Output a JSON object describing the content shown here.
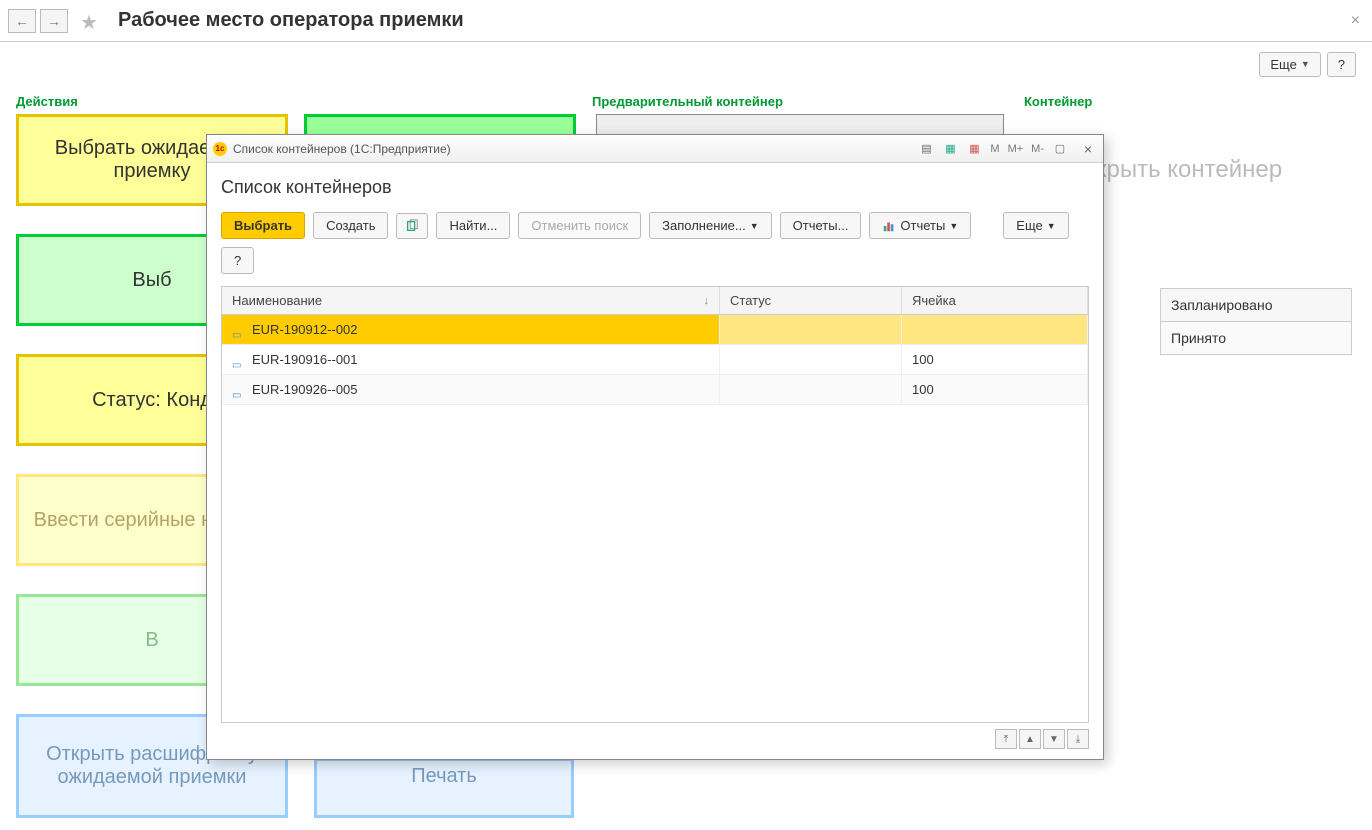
{
  "topbar": {
    "title": "Рабочее место оператора приемки",
    "more": "Еще",
    "help": "?"
  },
  "columns": {
    "actions": "Действия",
    "pre_container": "Предварительный контейнер",
    "container": "Контейнер"
  },
  "tiles": {
    "select_expected": "Выбрать ожидаемую приемку",
    "select_container_partial": "Выб",
    "status_cond": "Статус: Конд",
    "enter_serials": "Ввести серийные номера",
    "b_partial": "В",
    "open_breakdown": "Открыть расшифровку ожидаемой приемки",
    "pechat": "Печать",
    "right_grey": "крыть контейнер"
  },
  "right_table": {
    "planned": "Запланировано",
    "accepted": "Принято"
  },
  "dialog": {
    "titlebar": "Список контейнеров  (1С:Предприятие)",
    "heading": "Список контейнеров",
    "toolbar": {
      "select": "Выбрать",
      "create": "Создать",
      "find": "Найти...",
      "cancel_search": "Отменить поиск",
      "fill": "Заполнение...",
      "reports": "Отчеты...",
      "reports2": "Отчеты",
      "more": "Еще",
      "help": "?"
    },
    "cols": {
      "name": "Наименование",
      "status": "Статус",
      "cell": "Ячейка"
    },
    "rows": [
      {
        "name": "EUR-190912--002",
        "status": "",
        "cell": ""
      },
      {
        "name": "EUR-190916--001",
        "status": "",
        "cell": "100"
      },
      {
        "name": "EUR-190926--005",
        "status": "",
        "cell": "100"
      }
    ],
    "m_labels": {
      "m": "M",
      "mplus": "M+",
      "mminus": "M-"
    }
  }
}
